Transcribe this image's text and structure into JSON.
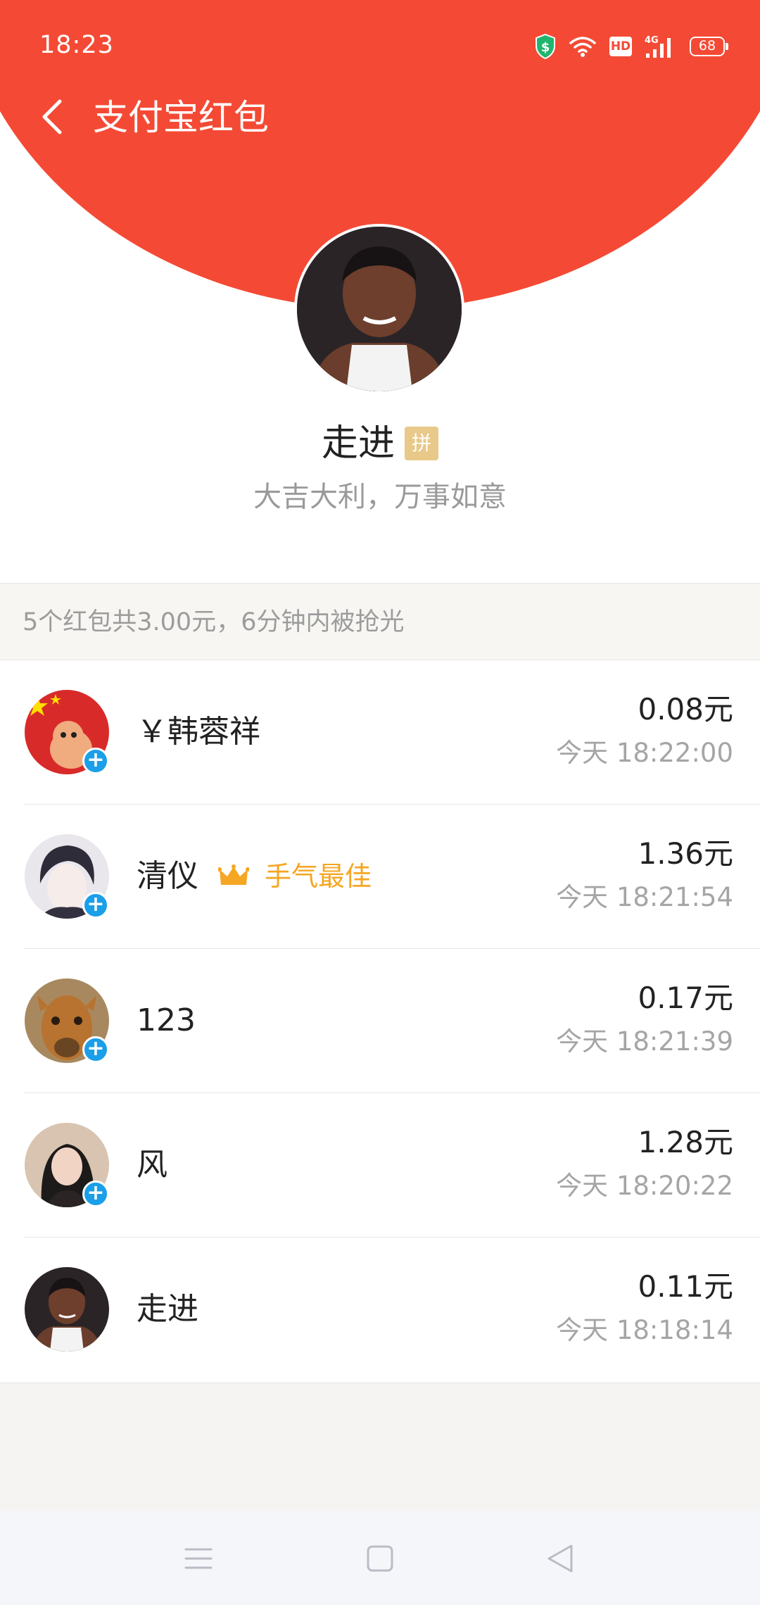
{
  "status_bar": {
    "time": "18:23",
    "network": "4G",
    "hd_label": "HD",
    "battery": "68"
  },
  "header": {
    "title": "支付宝红包",
    "back_icon": "chevron-left-icon"
  },
  "sender": {
    "name": "走进",
    "badge": "拼",
    "blessing": "大吉大利，万事如意"
  },
  "summary": "5个红包共3.00元，6分钟内被抢光",
  "recipients": [
    {
      "name": "￥韩蓉祥",
      "amount": "0.08元",
      "time": "今天 18:22:00",
      "best": false,
      "plus": true
    },
    {
      "name": "清仪",
      "amount": "1.36元",
      "time": "今天 18:21:54",
      "best": true,
      "best_label": "手气最佳",
      "plus": true
    },
    {
      "name": "123",
      "amount": "0.17元",
      "time": "今天 18:21:39",
      "best": false,
      "plus": true
    },
    {
      "name": "风",
      "amount": "1.28元",
      "time": "今天 18:20:22",
      "best": false,
      "plus": true
    },
    {
      "name": "走进",
      "amount": "0.11元",
      "time": "今天 18:18:14",
      "best": false,
      "plus": false
    }
  ],
  "colors": {
    "header_red": "#f44a35",
    "best_gold": "#f5a623",
    "plus_blue": "#1a9fe8",
    "badge_tan": "#e8c98a"
  },
  "system_nav": [
    "menu-icon",
    "home-icon",
    "back-triangle-icon"
  ]
}
